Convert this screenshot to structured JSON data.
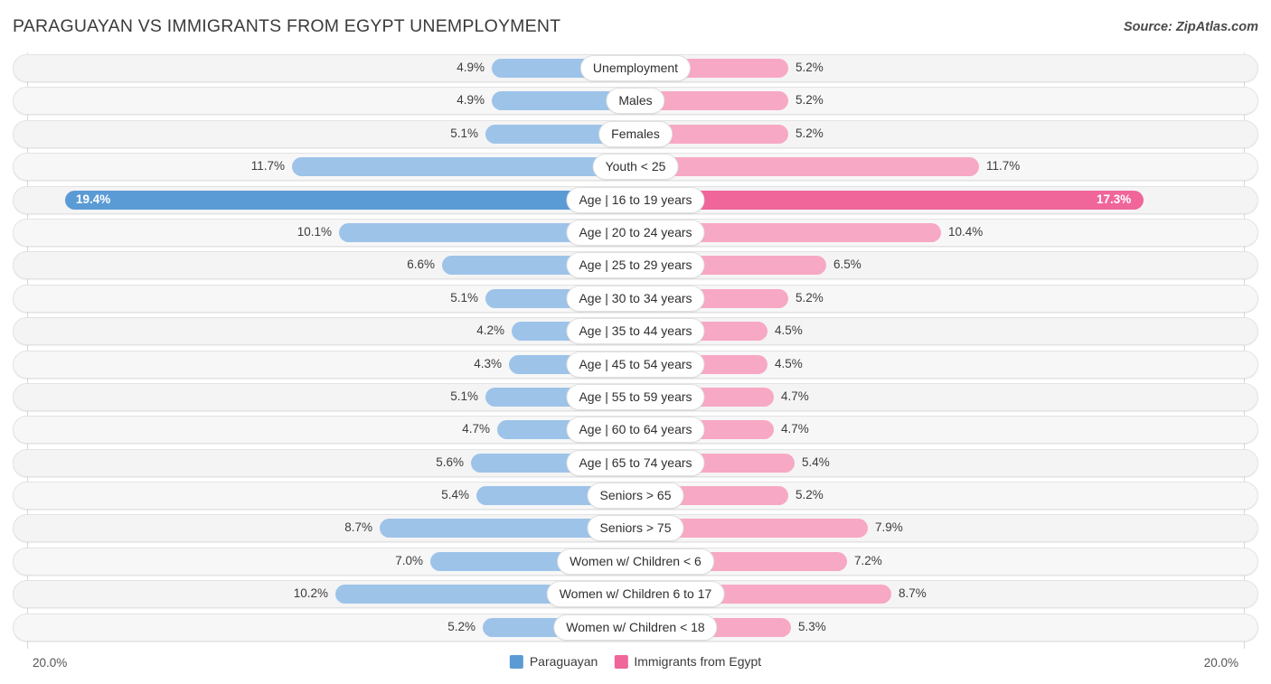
{
  "header": {
    "title": "PARAGUAYAN VS IMMIGRANTS FROM EGYPT UNEMPLOYMENT",
    "source": "Source: ZipAtlas.com"
  },
  "axis": {
    "left_tick": "20.0%",
    "right_tick": "20.0%",
    "max": 20.0
  },
  "legend": {
    "items": [
      {
        "label": "Paraguayan",
        "color": "#5b9bd5",
        "name": "legend-paraguayan"
      },
      {
        "label": "Immigrants from Egypt",
        "color": "#f0659a",
        "name": "legend-immigrants-from-egypt"
      }
    ]
  },
  "colors": {
    "left_bar": "#9dc3e9",
    "right_bar": "#f7a8c4",
    "left_bar_highlight": "#5b9bd5",
    "right_bar_highlight": "#f0659a",
    "track": "#f4f4f4",
    "title_text": "#3b3b3b"
  },
  "chart_data": {
    "type": "bar",
    "orientation": "horizontal-diverging",
    "title": "PARAGUAYAN VS IMMIGRANTS FROM EGYPT UNEMPLOYMENT",
    "xlabel": "",
    "ylabel": "",
    "xlim": [
      -20.0,
      20.0
    ],
    "grid": false,
    "legend_position": "bottom-center",
    "categories": [
      "Unemployment",
      "Males",
      "Females",
      "Youth < 25",
      "Age | 16 to 19 years",
      "Age | 20 to 24 years",
      "Age | 25 to 29 years",
      "Age | 30 to 34 years",
      "Age | 35 to 44 years",
      "Age | 45 to 54 years",
      "Age | 55 to 59 years",
      "Age | 60 to 64 years",
      "Age | 65 to 74 years",
      "Seniors > 65",
      "Seniors > 75",
      "Women w/ Children < 6",
      "Women w/ Children 6 to 17",
      "Women w/ Children < 18"
    ],
    "series": [
      {
        "name": "Paraguayan",
        "values": [
          4.9,
          4.9,
          5.1,
          11.7,
          19.4,
          10.1,
          6.6,
          5.1,
          4.2,
          4.3,
          5.1,
          4.7,
          5.6,
          5.4,
          8.7,
          7.0,
          10.2,
          5.2
        ],
        "labels": [
          "4.9%",
          "4.9%",
          "5.1%",
          "11.7%",
          "19.4%",
          "10.1%",
          "6.6%",
          "5.1%",
          "4.2%",
          "4.3%",
          "5.1%",
          "4.7%",
          "5.6%",
          "5.4%",
          "8.7%",
          "7.0%",
          "10.2%",
          "5.2%"
        ]
      },
      {
        "name": "Immigrants from Egypt",
        "values": [
          5.2,
          5.2,
          5.2,
          11.7,
          17.3,
          10.4,
          6.5,
          5.2,
          4.5,
          4.5,
          4.7,
          4.7,
          5.4,
          5.2,
          7.9,
          7.2,
          8.7,
          5.3
        ],
        "labels": [
          "5.2%",
          "5.2%",
          "5.2%",
          "11.7%",
          "17.3%",
          "10.4%",
          "6.5%",
          "5.2%",
          "4.5%",
          "4.5%",
          "4.7%",
          "4.7%",
          "5.4%",
          "5.2%",
          "7.9%",
          "7.2%",
          "8.7%",
          "5.3%"
        ]
      }
    ],
    "highlight_index": 4
  }
}
